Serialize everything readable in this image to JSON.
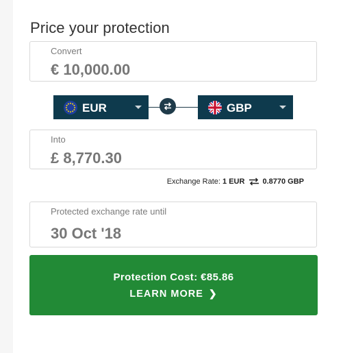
{
  "title": "Price your protection",
  "convert": {
    "label": "Convert",
    "value": "€ 10,000.00"
  },
  "from_currency": {
    "code": "EUR",
    "flag": "eu-flag-icon"
  },
  "to_currency": {
    "code": "GBP",
    "flag": "uk-flag-icon"
  },
  "into": {
    "label": "Into",
    "value": "£ 8,770.30"
  },
  "rate": {
    "label": "Exchange Rate:",
    "from": "1 EUR",
    "to": "0.8770 GBP"
  },
  "protected_until": {
    "label": "Protected exchange rate until",
    "value": "30 Oct '18"
  },
  "cta": {
    "cost": "Protection Cost: €85.86",
    "more": "LEARN MORE"
  },
  "colors": {
    "navy": "#0e3a4d",
    "green": "#228a36",
    "border": "#d8d8d8"
  }
}
